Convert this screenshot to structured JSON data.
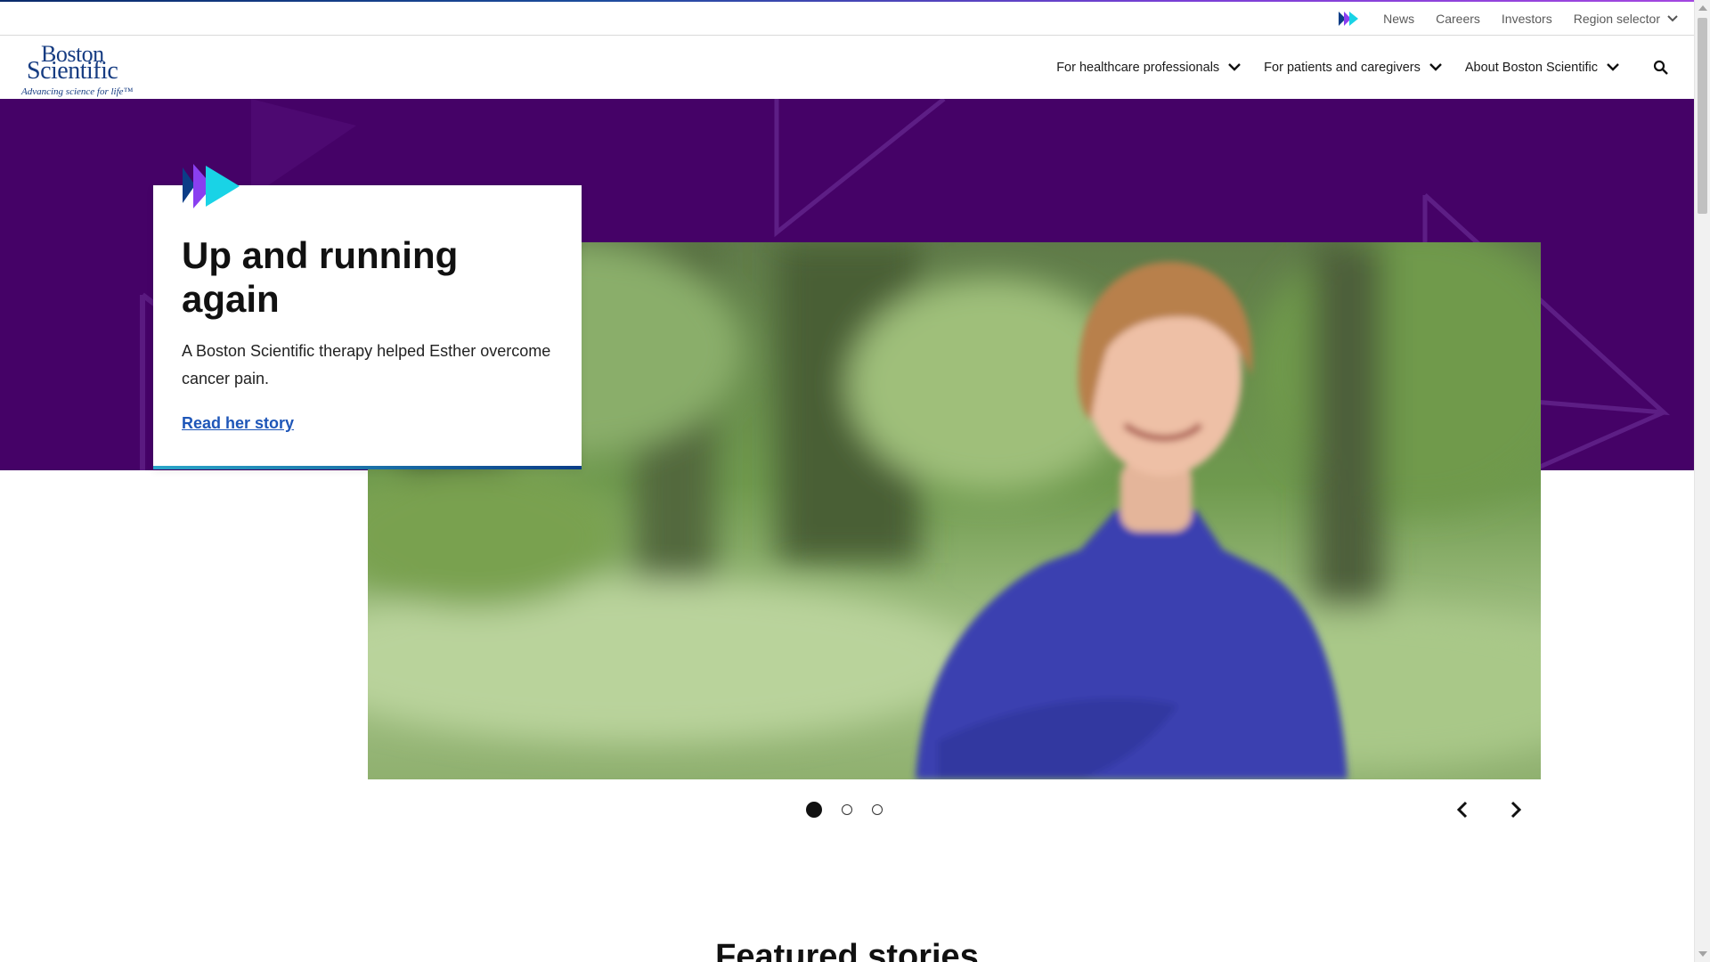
{
  "utility_bar": {
    "links": [
      "News",
      "Careers",
      "Investors"
    ],
    "region_label": "Region selector"
  },
  "logo": {
    "line1": "Boston",
    "line2": "Scientific",
    "tagline": "Advancing science for life™"
  },
  "nav": {
    "items": [
      "For healthcare professionals",
      "For patients and caregivers",
      "About Boston Scientific"
    ]
  },
  "hero": {
    "title": "Up and running again",
    "description": "A Boston Scientific therapy helped Esther overcome cancer pain.",
    "link": "Read her story"
  },
  "carousel": {
    "slide_count": 3,
    "active_slide": 1
  },
  "featured_heading": "Featured stories",
  "colors": {
    "hero_purple": "#450267",
    "brand_blue": "#163c82",
    "link_blue": "#1e56b8",
    "accent_cyan": "#19d3e6",
    "accent_violet": "#8a3ff0"
  },
  "icons": [
    "brand-arrows-icon",
    "chevron-down-icon",
    "search-icon",
    "chevron-left-icon",
    "chevron-right-icon"
  ]
}
